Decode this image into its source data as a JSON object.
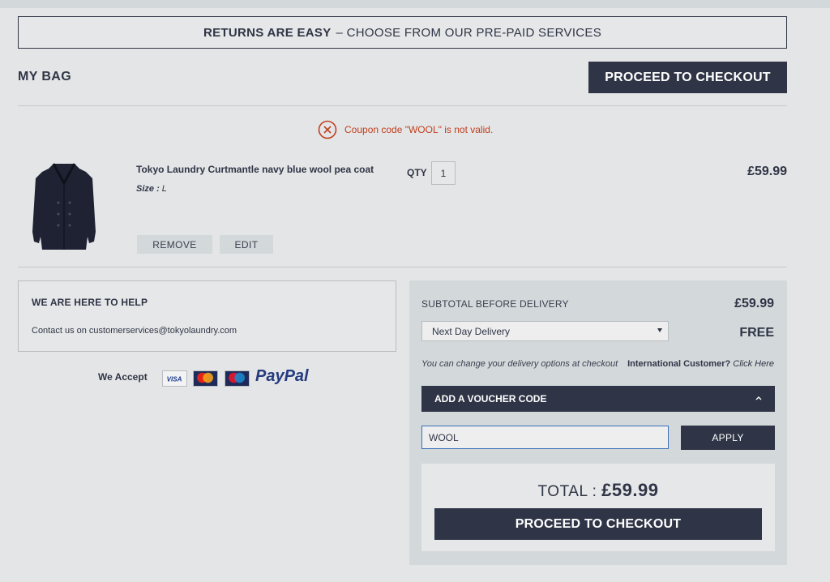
{
  "banner": {
    "bold": "RETURNS ARE EASY",
    "rest": "– CHOOSE FROM OUR PRE-PAID SERVICES"
  },
  "page_title": "MY BAG",
  "checkout_label": "PROCEED TO CHECKOUT",
  "error_message": "Coupon code \"WOOL\" is not valid.",
  "item": {
    "name": "Tokyo Laundry Curtmantle navy blue wool pea coat",
    "size_label": "Size :",
    "size_value": "L",
    "qty_label": "QTY",
    "qty_value": "1",
    "price": "£59.99",
    "remove_label": "REMOVE",
    "edit_label": "EDIT"
  },
  "help": {
    "title": "WE ARE HERE TO HELP",
    "text": "Contact us on customerservices@tokyolaundry.com"
  },
  "payments": {
    "label": "We Accept",
    "cards": [
      "VISA",
      "MasterCard",
      "Maestro"
    ],
    "paypal": "PayPal"
  },
  "summary": {
    "subtotal_label": "SUBTOTAL BEFORE DELIVERY",
    "subtotal_value": "£59.99",
    "delivery_option": "Next Day Delivery",
    "delivery_cost": "FREE",
    "delivery_note": "You can change your delivery options at checkout",
    "intl_bold": "International Customer?",
    "intl_link": "Click Here",
    "voucher_label": "ADD A VOUCHER CODE",
    "voucher_value": "WOOL",
    "apply_label": "APPLY",
    "total_label": "TOTAL :",
    "total_value": "£59.99"
  },
  "colors": {
    "navy": "#2f3546",
    "error": "#c0401f",
    "panel": "#d3d8da"
  }
}
